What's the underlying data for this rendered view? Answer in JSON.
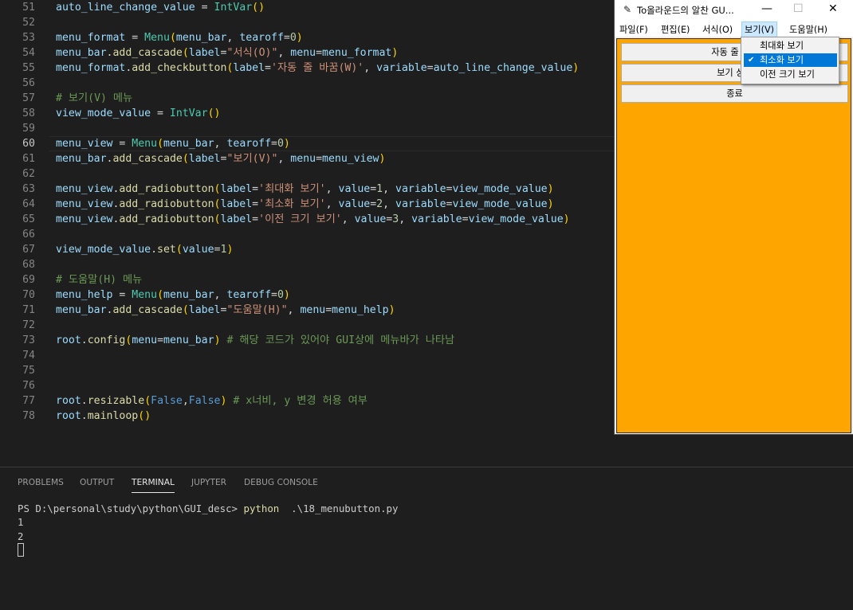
{
  "editor": {
    "lines": [
      {
        "n": "51",
        "code": [
          [
            "v",
            "auto_line_change_value"
          ],
          [
            "p",
            " = "
          ],
          [
            "c",
            "IntVar"
          ],
          [
            "y",
            "()"
          ]
        ]
      },
      {
        "n": "52",
        "code": []
      },
      {
        "n": "53",
        "code": [
          [
            "v",
            "menu_format"
          ],
          [
            "p",
            " = "
          ],
          [
            "c",
            "Menu"
          ],
          [
            "y",
            "("
          ],
          [
            "v",
            "menu_bar"
          ],
          [
            "p",
            ", "
          ],
          [
            "v",
            "tearoff"
          ],
          [
            "p",
            "="
          ],
          [
            "n",
            "0"
          ],
          [
            "y",
            ")"
          ]
        ]
      },
      {
        "n": "54",
        "code": [
          [
            "v",
            "menu_bar"
          ],
          [
            "p",
            "."
          ],
          [
            "f",
            "add_cascade"
          ],
          [
            "y",
            "("
          ],
          [
            "v",
            "label"
          ],
          [
            "p",
            "="
          ],
          [
            "s",
            "\"서식(O)\""
          ],
          [
            "p",
            ", "
          ],
          [
            "v",
            "menu"
          ],
          [
            "p",
            "="
          ],
          [
            "v",
            "menu_format"
          ],
          [
            "y",
            ")"
          ]
        ]
      },
      {
        "n": "55",
        "code": [
          [
            "v",
            "menu_format"
          ],
          [
            "p",
            "."
          ],
          [
            "f",
            "add_checkbutton"
          ],
          [
            "y",
            "("
          ],
          [
            "v",
            "label"
          ],
          [
            "p",
            "="
          ],
          [
            "s",
            "'자동 줄 바꿈(W)'"
          ],
          [
            "p",
            ", "
          ],
          [
            "v",
            "variable"
          ],
          [
            "p",
            "="
          ],
          [
            "v",
            "auto_line_change_value"
          ],
          [
            "y",
            ")"
          ]
        ]
      },
      {
        "n": "56",
        "code": []
      },
      {
        "n": "57",
        "code": [
          [
            "cm",
            "# 보기(V) 메뉴"
          ]
        ]
      },
      {
        "n": "58",
        "code": [
          [
            "v",
            "view_mode_value"
          ],
          [
            "p",
            " = "
          ],
          [
            "c",
            "IntVar"
          ],
          [
            "y",
            "()"
          ]
        ]
      },
      {
        "n": "59",
        "code": []
      },
      {
        "n": "60",
        "code": [
          [
            "v",
            "menu_view"
          ],
          [
            "p",
            " = "
          ],
          [
            "c",
            "Menu"
          ],
          [
            "y",
            "("
          ],
          [
            "v",
            "menu_bar"
          ],
          [
            "p",
            ", "
          ],
          [
            "v",
            "tearoff"
          ],
          [
            "p",
            "="
          ],
          [
            "n",
            "0"
          ],
          [
            "y",
            ")"
          ]
        ]
      },
      {
        "n": "61",
        "code": [
          [
            "v",
            "menu_bar"
          ],
          [
            "p",
            "."
          ],
          [
            "f",
            "add_cascade"
          ],
          [
            "y",
            "("
          ],
          [
            "v",
            "label"
          ],
          [
            "p",
            "="
          ],
          [
            "s",
            "\"보기(V)\""
          ],
          [
            "p",
            ", "
          ],
          [
            "v",
            "menu"
          ],
          [
            "p",
            "="
          ],
          [
            "v",
            "menu_view"
          ],
          [
            "y",
            ")"
          ]
        ]
      },
      {
        "n": "62",
        "code": []
      },
      {
        "n": "63",
        "code": [
          [
            "v",
            "menu_view"
          ],
          [
            "p",
            "."
          ],
          [
            "f",
            "add_radiobutton"
          ],
          [
            "y",
            "("
          ],
          [
            "v",
            "label"
          ],
          [
            "p",
            "="
          ],
          [
            "s",
            "'최대화 보기'"
          ],
          [
            "p",
            ", "
          ],
          [
            "v",
            "value"
          ],
          [
            "p",
            "="
          ],
          [
            "n",
            "1"
          ],
          [
            "p",
            ", "
          ],
          [
            "v",
            "variable"
          ],
          [
            "p",
            "="
          ],
          [
            "v",
            "view_mode_value"
          ],
          [
            "y",
            ")"
          ]
        ]
      },
      {
        "n": "64",
        "code": [
          [
            "v",
            "menu_view"
          ],
          [
            "p",
            "."
          ],
          [
            "f",
            "add_radiobutton"
          ],
          [
            "y",
            "("
          ],
          [
            "v",
            "label"
          ],
          [
            "p",
            "="
          ],
          [
            "s",
            "'최소화 보기'"
          ],
          [
            "p",
            ", "
          ],
          [
            "v",
            "value"
          ],
          [
            "p",
            "="
          ],
          [
            "n",
            "2"
          ],
          [
            "p",
            ", "
          ],
          [
            "v",
            "variable"
          ],
          [
            "p",
            "="
          ],
          [
            "v",
            "view_mode_value"
          ],
          [
            "y",
            ")"
          ]
        ]
      },
      {
        "n": "65",
        "code": [
          [
            "v",
            "menu_view"
          ],
          [
            "p",
            "."
          ],
          [
            "f",
            "add_radiobutton"
          ],
          [
            "y",
            "("
          ],
          [
            "v",
            "label"
          ],
          [
            "p",
            "="
          ],
          [
            "s",
            "'이전 크기 보기'"
          ],
          [
            "p",
            ", "
          ],
          [
            "v",
            "value"
          ],
          [
            "p",
            "="
          ],
          [
            "n",
            "3"
          ],
          [
            "p",
            ", "
          ],
          [
            "v",
            "variable"
          ],
          [
            "p",
            "="
          ],
          [
            "v",
            "view_mode_value"
          ],
          [
            "y",
            ")"
          ]
        ]
      },
      {
        "n": "66",
        "code": []
      },
      {
        "n": "67",
        "code": [
          [
            "v",
            "view_mode_value"
          ],
          [
            "p",
            "."
          ],
          [
            "f",
            "set"
          ],
          [
            "y",
            "("
          ],
          [
            "v",
            "value"
          ],
          [
            "p",
            "="
          ],
          [
            "n",
            "1"
          ],
          [
            "y",
            ")"
          ]
        ]
      },
      {
        "n": "68",
        "code": []
      },
      {
        "n": "69",
        "code": [
          [
            "cm",
            "# 도움말(H) 메뉴"
          ]
        ]
      },
      {
        "n": "70",
        "code": [
          [
            "v",
            "menu_help"
          ],
          [
            "p",
            " = "
          ],
          [
            "c",
            "Menu"
          ],
          [
            "y",
            "("
          ],
          [
            "v",
            "menu_bar"
          ],
          [
            "p",
            ", "
          ],
          [
            "v",
            "tearoff"
          ],
          [
            "p",
            "="
          ],
          [
            "n",
            "0"
          ],
          [
            "y",
            ")"
          ]
        ]
      },
      {
        "n": "71",
        "code": [
          [
            "v",
            "menu_bar"
          ],
          [
            "p",
            "."
          ],
          [
            "f",
            "add_cascade"
          ],
          [
            "y",
            "("
          ],
          [
            "v",
            "label"
          ],
          [
            "p",
            "="
          ],
          [
            "s",
            "\"도움말(H)\""
          ],
          [
            "p",
            ", "
          ],
          [
            "v",
            "menu"
          ],
          [
            "p",
            "="
          ],
          [
            "v",
            "menu_help"
          ],
          [
            "y",
            ")"
          ]
        ]
      },
      {
        "n": "72",
        "code": []
      },
      {
        "n": "73",
        "code": [
          [
            "v",
            "root"
          ],
          [
            "p",
            "."
          ],
          [
            "f",
            "config"
          ],
          [
            "y",
            "("
          ],
          [
            "v",
            "menu"
          ],
          [
            "p",
            "="
          ],
          [
            "v",
            "menu_bar"
          ],
          [
            "y",
            ")"
          ],
          [
            "p",
            " "
          ],
          [
            "cm",
            "# 해당 코드가 있어야 GUI상에 메뉴바가 나타남"
          ]
        ]
      },
      {
        "n": "74",
        "code": []
      },
      {
        "n": "75",
        "code": []
      },
      {
        "n": "76",
        "code": []
      },
      {
        "n": "77",
        "code": [
          [
            "v",
            "root"
          ],
          [
            "p",
            "."
          ],
          [
            "f",
            "resizable"
          ],
          [
            "y",
            "("
          ],
          [
            "k",
            "False"
          ],
          [
            "p",
            ","
          ],
          [
            "k",
            "False"
          ],
          [
            "y",
            ")"
          ],
          [
            "p",
            " "
          ],
          [
            "cm",
            "# x너비, y 변경 허용 여부"
          ]
        ]
      },
      {
        "n": "78",
        "code": [
          [
            "v",
            "root"
          ],
          [
            "p",
            "."
          ],
          [
            "f",
            "mainloop"
          ],
          [
            "y",
            "()"
          ]
        ]
      }
    ],
    "active_line": "60"
  },
  "panel": {
    "tabs": [
      "PROBLEMS",
      "OUTPUT",
      "TERMINAL",
      "JUPYTER",
      "DEBUG CONSOLE"
    ],
    "active_tab": "TERMINAL",
    "terminal": {
      "prompt": "PS D:\\personal\\study\\python\\GUI_desc> ",
      "command": "python",
      "args": "  .\\18_menubutton.py",
      "output": [
        "1",
        "2"
      ]
    }
  },
  "window": {
    "title": "To올라운드의 알찬 GU...",
    "minimize": "—",
    "maximize": "☐",
    "close": "✕",
    "menus": [
      "파일(F)",
      "편집(E)",
      "서식(O)",
      "보기(V)",
      "도움말(H)"
    ],
    "open_menu": "보기(V)",
    "buttons": [
      "자동 줄 바뀜",
      "보기 상태",
      "종료"
    ],
    "background_color": "#ffa500"
  },
  "dropdown": {
    "items": [
      {
        "label": "최대화 보기",
        "checked": false,
        "highlighted": false
      },
      {
        "label": "최소화 보기",
        "checked": true,
        "highlighted": true
      },
      {
        "label": "이전 크기 보기",
        "checked": false,
        "highlighted": false
      }
    ],
    "check_mark": "✔"
  }
}
